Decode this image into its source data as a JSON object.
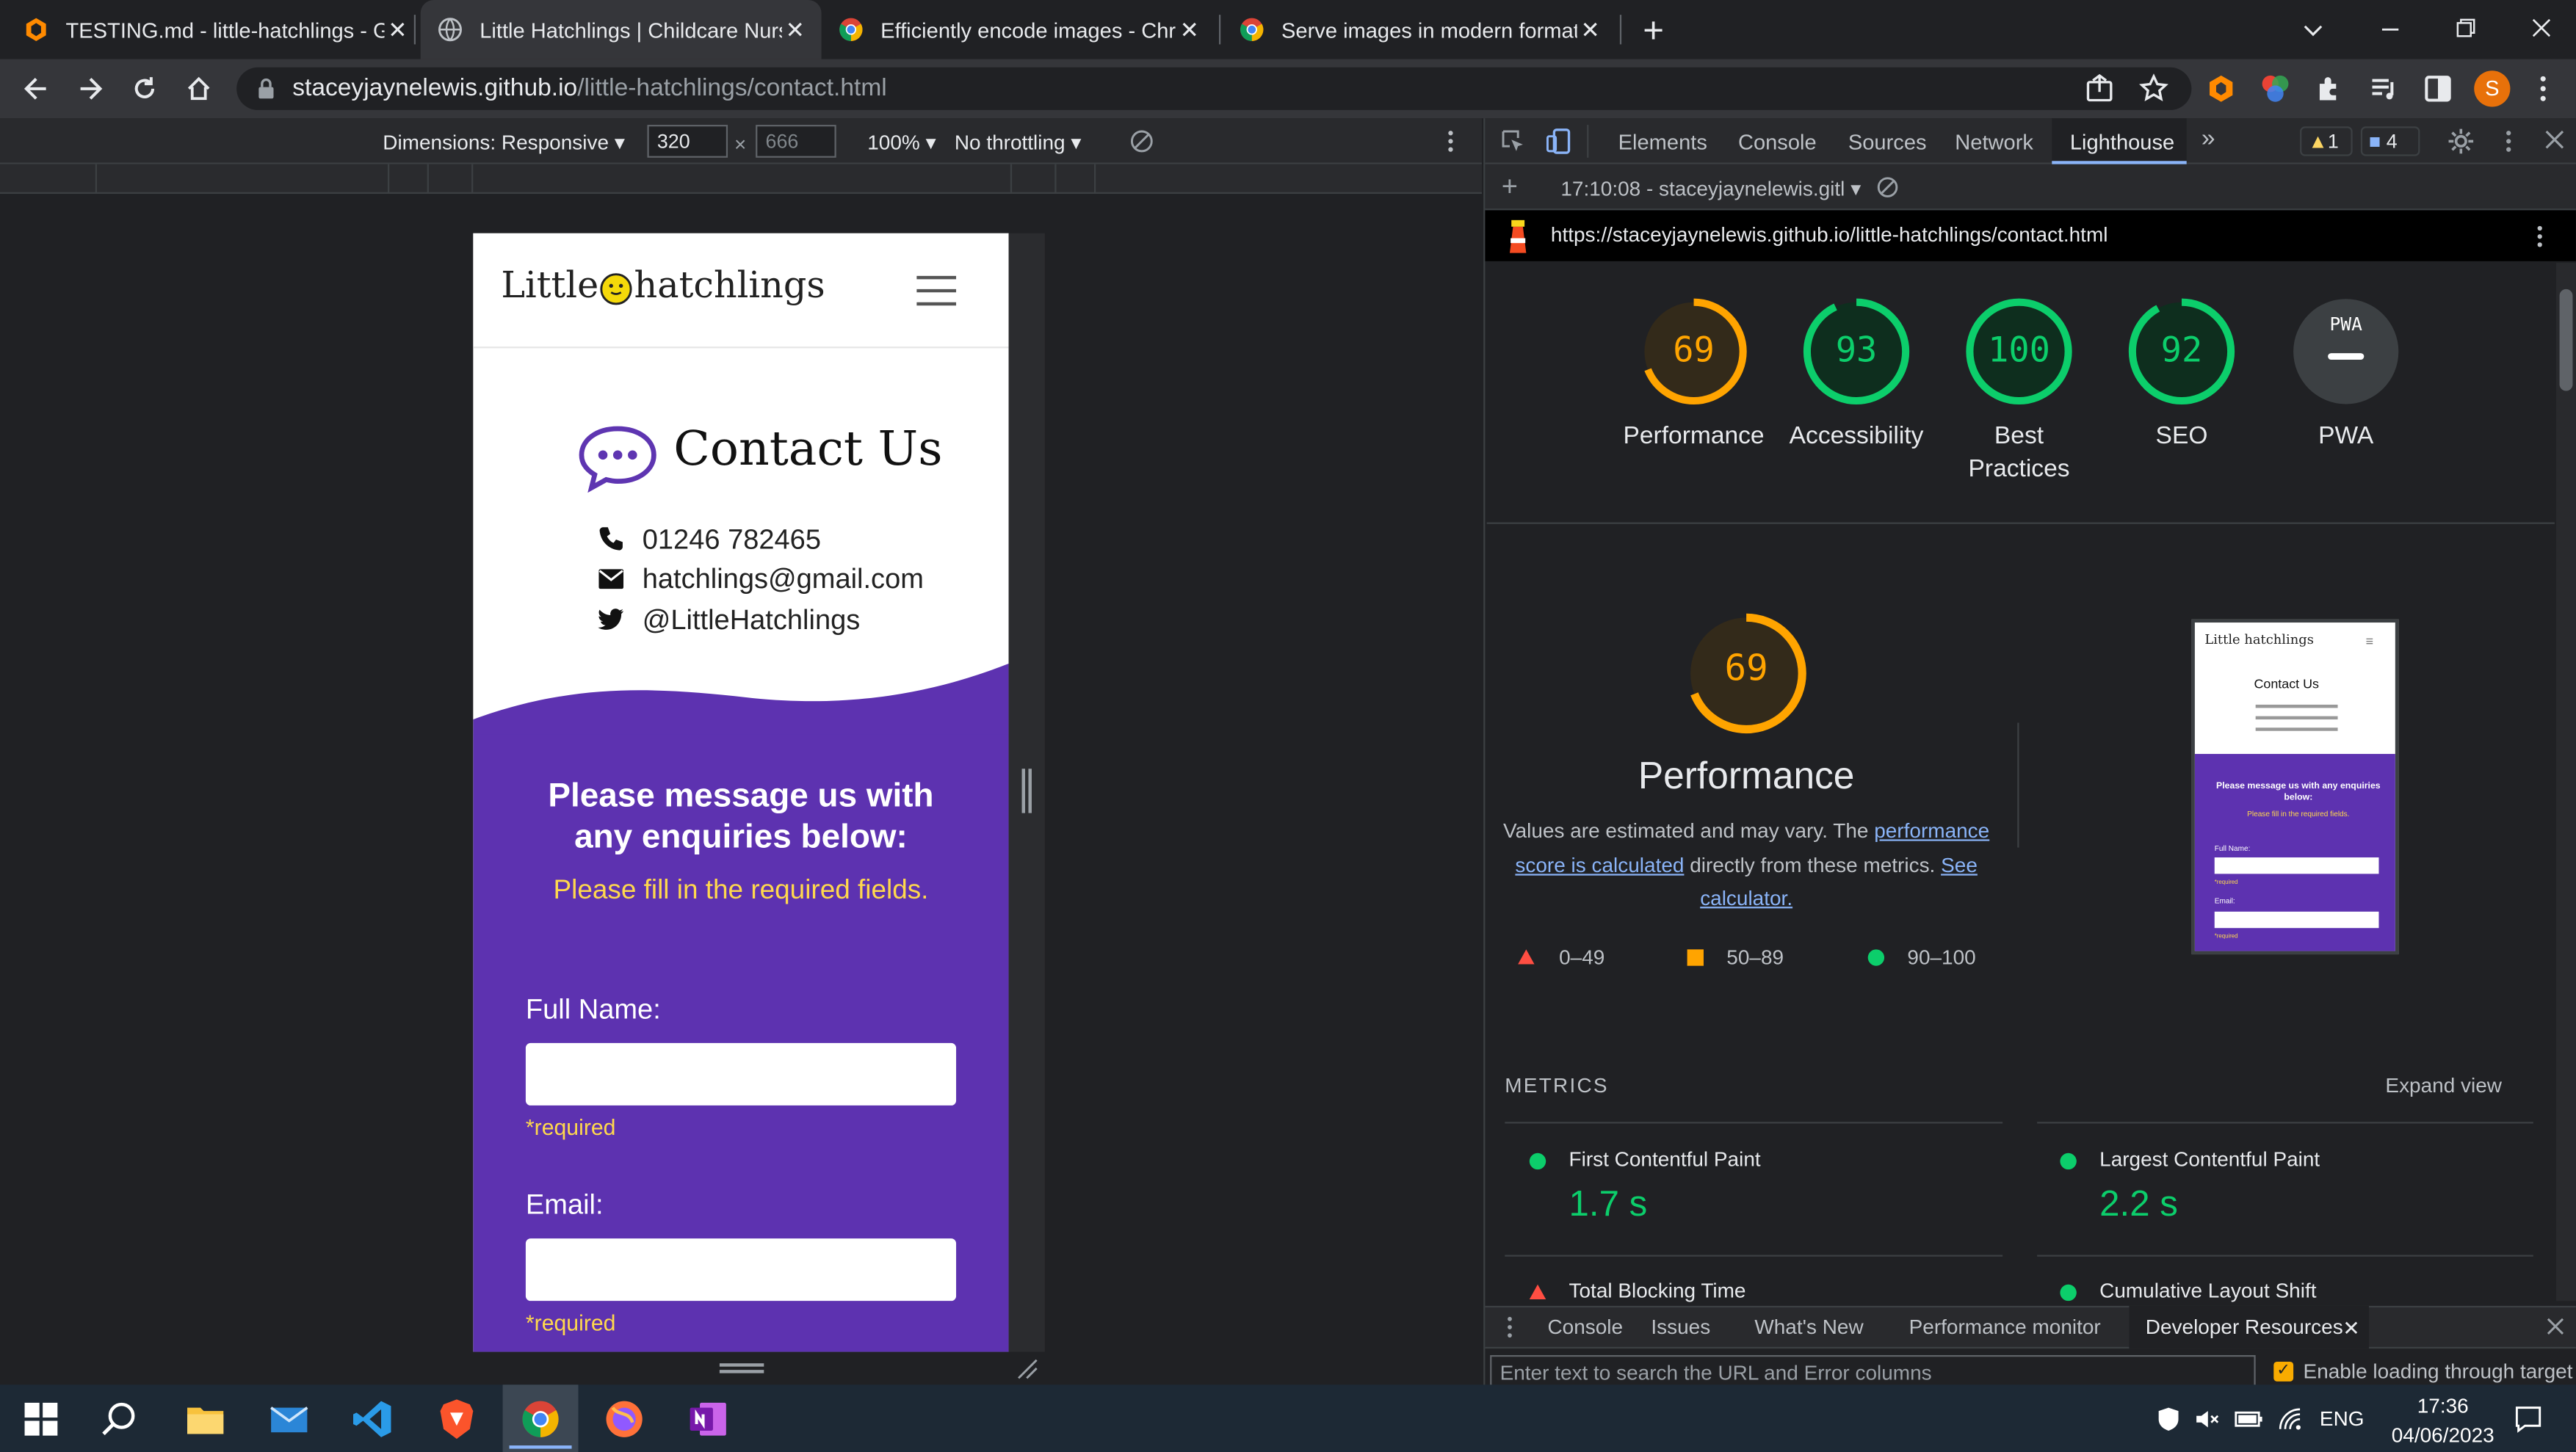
{
  "tabs": [
    {
      "title": "TESTING.md - little-hatchlings - G",
      "close": "✕"
    },
    {
      "title": "Little Hatchlings | Childcare Nursery",
      "close": "✕"
    },
    {
      "title": "Efficiently encode images - Chrome",
      "close": "✕"
    },
    {
      "title": "Serve images in modern formats",
      "close": "✕"
    }
  ],
  "new_tab": "+",
  "address": {
    "host": "staceyjaynelewis.github.io",
    "path": "/little-hatchlings/contact.html"
  },
  "profile_initial": "S",
  "device_toolbar": {
    "dimensions_label": "Dimensions: Responsive",
    "width": "320",
    "height": "666",
    "times": "×",
    "zoom": "100%",
    "throttling": "No throttling"
  },
  "page": {
    "logo_left": "Little",
    "logo_right": "hatchlings",
    "contact_title": "Contact Us",
    "phone": "01246 782465",
    "email": "hatchlings@gmail.com",
    "twitter": "@LittleHatchlings",
    "message_heading_1": "Please message us with",
    "message_heading_2": "any enquiries below:",
    "required_note": "Please fill in the required fields.",
    "full_name_label": "Full Name:",
    "email_label": "Email:",
    "required": "*required"
  },
  "devtools": {
    "tabs": [
      "Elements",
      "Console",
      "Sources",
      "Network",
      "Lighthouse"
    ],
    "more": "»",
    "warnings": "1",
    "messages": "4",
    "report_selector": "17:10:08 - staceyjaynelewis.gitl",
    "report_url": "https://staceyjaynelewis.github.io/little-hatchlings/contact.html",
    "scores": [
      {
        "label": "Performance",
        "value": "69",
        "color": "#ffa400"
      },
      {
        "label": "Accessibility",
        "value": "93",
        "color": "#0cce6b"
      },
      {
        "label": "Best Practices",
        "value": "100",
        "color": "#0cce6b"
      },
      {
        "label": "SEO",
        "value": "92",
        "color": "#0cce6b"
      },
      {
        "label": "PWA",
        "value": "",
        "color": "#9aa0a6"
      }
    ],
    "pwa_badge": "PWA",
    "big_score": "69",
    "big_label": "Performance",
    "desc_1": "Values are estimated and may vary. The ",
    "desc_link_1": "performance score is calculated",
    "desc_2": " directly from these metrics. ",
    "desc_link_2": "See calculator.",
    "legend": [
      {
        "range": "0–49",
        "color": "#ff4e42"
      },
      {
        "range": "50–89",
        "color": "#ffa400"
      },
      {
        "range": "90–100",
        "color": "#0cce6b"
      }
    ],
    "thumb": {
      "logo": "Little hatchlings",
      "title": "Contact Us",
      "heading": "Please message us with any enquiries below:",
      "note": "Please fill in the required fields.",
      "name": "Full Name:",
      "email": "Email:",
      "required": "*required"
    },
    "metrics_header": "METRICS",
    "expand_view": "Expand view",
    "metrics": [
      {
        "name": "First Contentful Paint",
        "value": "1.7 s",
        "status": "good"
      },
      {
        "name": "Largest Contentful Paint",
        "value": "2.2 s",
        "status": "good"
      },
      {
        "name": "Total Blocking Time",
        "value": "",
        "status": "poor"
      },
      {
        "name": "Cumulative Layout Shift",
        "value": "",
        "status": "good"
      }
    ],
    "drawer_tabs": [
      "Console",
      "Issues",
      "What's New",
      "Performance monitor",
      "Developer Resources"
    ],
    "drawer_close": "✕",
    "filter_placeholder": "Enter text to search the URL and Error columns",
    "enable_loading": "Enable loading through target"
  },
  "taskbar": {
    "lang": "ENG",
    "time": "17:36",
    "date": "04/06/2023"
  }
}
